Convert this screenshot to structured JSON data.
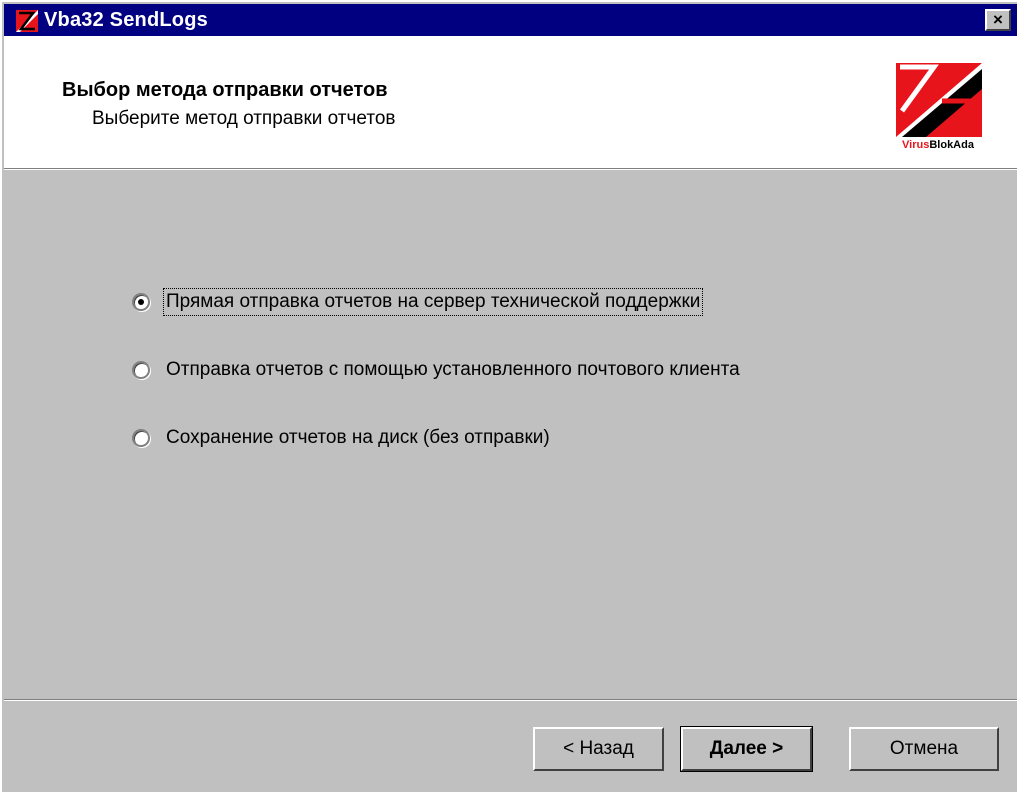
{
  "window": {
    "title": "Vba32 SendLogs",
    "close_glyph": "×",
    "icon": "vba32-app-icon"
  },
  "header": {
    "title": "Выбор метода отправки отчетов",
    "subtitle": "Выберите метод отправки отчетов",
    "logo": {
      "icon": "virusblokada-logo",
      "text_part1": "Virus",
      "text_part2": "BlokAda"
    }
  },
  "options": [
    {
      "label": "Прямая отправка отчетов на сервер технической поддержки",
      "checked": true
    },
    {
      "label": "Отправка отчетов с помощью установленного почтового клиента",
      "checked": false
    },
    {
      "label": "Сохранение отчетов на диск (без отправки)",
      "checked": false
    }
  ],
  "buttons": {
    "back": "< Назад",
    "next": "Далее >",
    "cancel": "Отмена"
  },
  "colors": {
    "titlebar": "#000080",
    "dialog": "#c0c0c0",
    "logo_red": "#e8141c"
  }
}
